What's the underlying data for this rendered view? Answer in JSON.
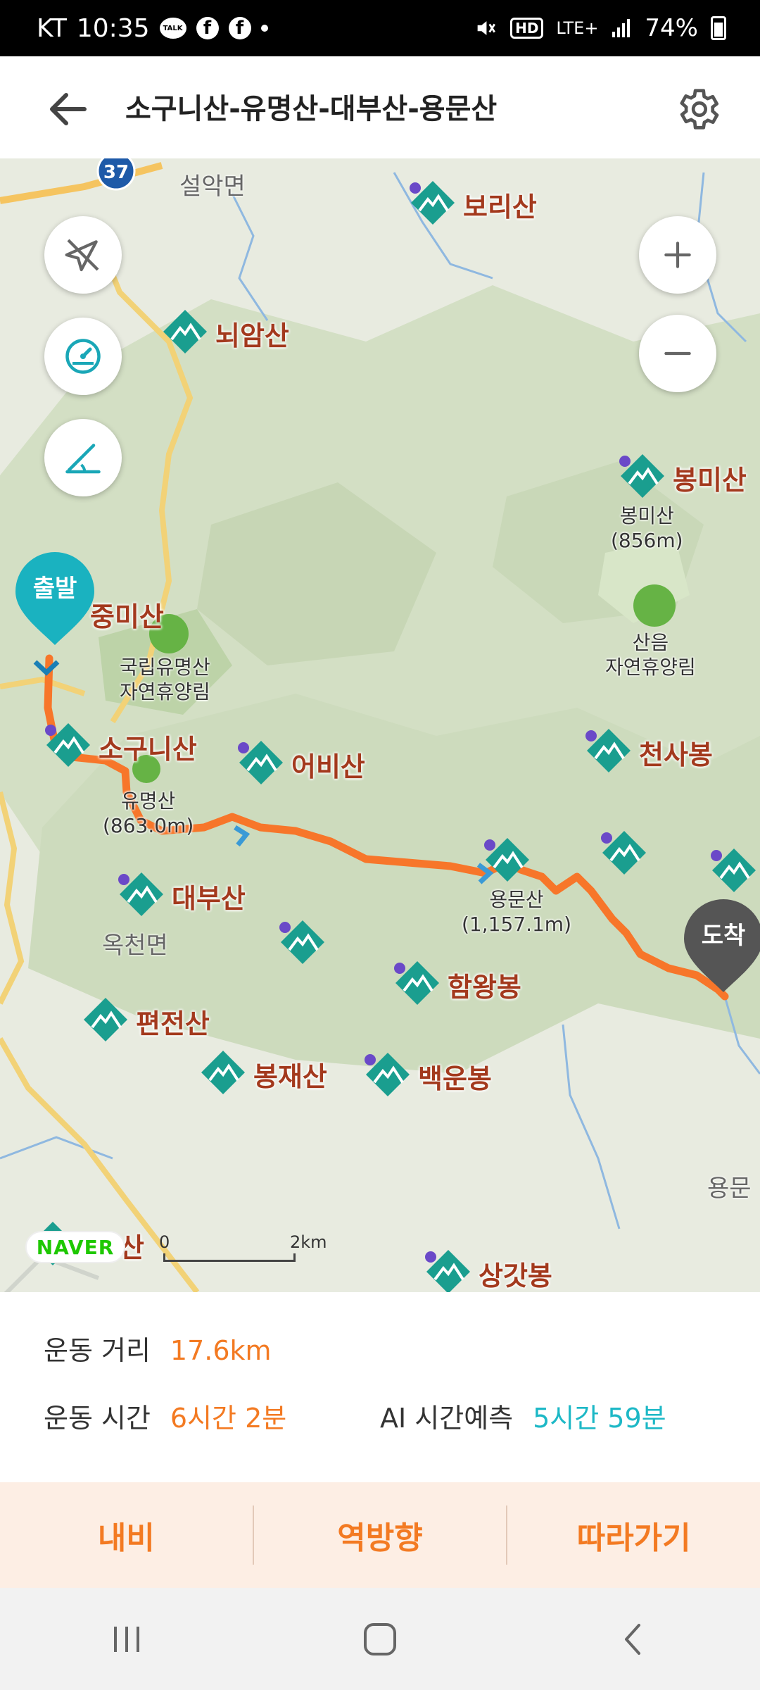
{
  "status_bar": {
    "carrier": "KT",
    "time": "10:35",
    "talk_icon_label": "TALK",
    "facebook_icon_letter": "f",
    "hd_label": "HD",
    "network": "LTE+",
    "battery": "74%"
  },
  "header": {
    "title": "소구니산-유명산-대부산-용문산"
  },
  "map": {
    "place_labels": [
      "설악면",
      "옥천면",
      "용문"
    ],
    "road_badge": "37",
    "peaks": [
      "보리산",
      "뇌암산",
      "봉미산",
      "중미산",
      "소구니산",
      "어비산",
      "천사봉",
      "대부산",
      "함왕봉",
      "편전산",
      "봉재산",
      "백운봉",
      "상갓봉"
    ],
    "poi": {
      "bongmi": "봉미산\n(856m)",
      "sanum": "산음\n자연휴양림",
      "gukrip": "국립유명산\n자연휴양림",
      "yumyeong": "유명산\n(863.0m)",
      "yongmun": "용문산\n(1,157.1m)"
    },
    "start_marker": "출발",
    "end_marker": "도착",
    "naver_logo": "NAVER",
    "partial_peak_suffix": "산",
    "scale": {
      "start": "0",
      "end": "2km"
    },
    "colors": {
      "route": "#f7762a",
      "peak_pin": "#1a9e8f",
      "start": "#1ab2c0",
      "end": "#555555"
    }
  },
  "stats": {
    "distance_label": "운동 거리",
    "distance_value": "17.6km",
    "time_label": "운동 시간",
    "time_value": "6시간 2분",
    "ai_label": "AI 시간예측",
    "ai_value": "5시간 59분"
  },
  "actions": {
    "navi": "내비",
    "reverse": "역방향",
    "follow": "따라가기"
  }
}
